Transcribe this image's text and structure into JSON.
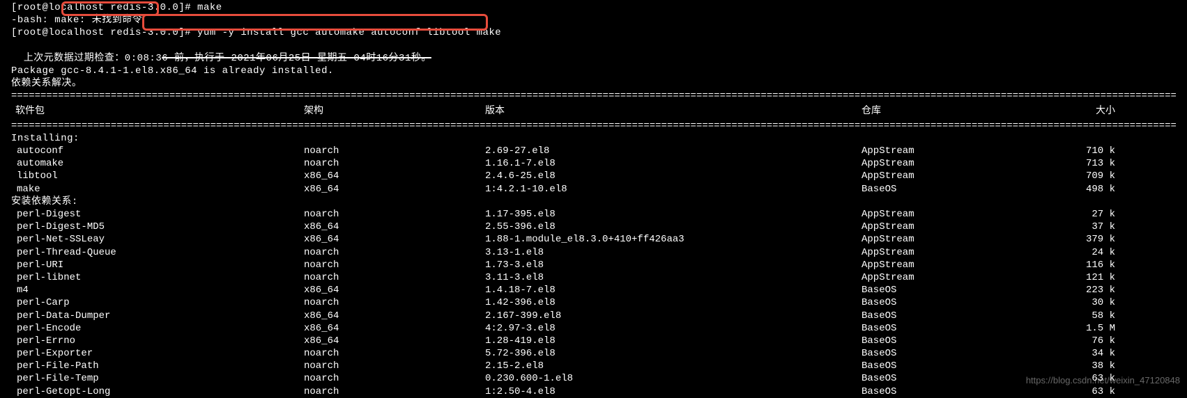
{
  "terminal": {
    "line0": "[root@localhost redis-3.0.0]# make",
    "line1": "-bash: make: 未找到命令",
    "line2": "[root@localhost redis-3.0.0]# yum -y install gcc automake autoconf libtool make",
    "line3_prefix": "上次元数据过期检查：0:08:3",
    "line3_struck": "6 前，执行于 2021年06月25日 星期五 04时16分31秒。",
    "line4": "Package gcc-8.4.1-1.el8.x86_64 is already installed.",
    "line5": "依赖关系解决。"
  },
  "headers": {
    "package": " 软件包",
    "arch": "架构",
    "version": "版本",
    "repo": "仓库",
    "size": "大小"
  },
  "sections": {
    "installing": "Installing:",
    "deps": "安装依赖关系:"
  },
  "installing": [
    {
      "name": "autoconf",
      "arch": "noarch",
      "version": "2.69-27.el8",
      "repo": "AppStream",
      "size": "710 k"
    },
    {
      "name": "automake",
      "arch": "noarch",
      "version": "1.16.1-7.el8",
      "repo": "AppStream",
      "size": "713 k"
    },
    {
      "name": "libtool",
      "arch": "x86_64",
      "version": "2.4.6-25.el8",
      "repo": "AppStream",
      "size": "709 k"
    },
    {
      "name": "make",
      "arch": "x86_64",
      "version": "1:4.2.1-10.el8",
      "repo": "BaseOS",
      "size": "498 k"
    }
  ],
  "deps": [
    {
      "name": "perl-Digest",
      "arch": "noarch",
      "version": "1.17-395.el8",
      "repo": "AppStream",
      "size": "27 k"
    },
    {
      "name": "perl-Digest-MD5",
      "arch": "x86_64",
      "version": "2.55-396.el8",
      "repo": "AppStream",
      "size": "37 k"
    },
    {
      "name": "perl-Net-SSLeay",
      "arch": "x86_64",
      "version": "1.88-1.module_el8.3.0+410+ff426aa3",
      "repo": "AppStream",
      "size": "379 k"
    },
    {
      "name": "perl-Thread-Queue",
      "arch": "noarch",
      "version": "3.13-1.el8",
      "repo": "AppStream",
      "size": "24 k"
    },
    {
      "name": "perl-URI",
      "arch": "noarch",
      "version": "1.73-3.el8",
      "repo": "AppStream",
      "size": "116 k"
    },
    {
      "name": "perl-libnet",
      "arch": "noarch",
      "version": "3.11-3.el8",
      "repo": "AppStream",
      "size": "121 k"
    },
    {
      "name": "m4",
      "arch": "x86_64",
      "version": "1.4.18-7.el8",
      "repo": "BaseOS",
      "size": "223 k"
    },
    {
      "name": "perl-Carp",
      "arch": "noarch",
      "version": "1.42-396.el8",
      "repo": "BaseOS",
      "size": "30 k"
    },
    {
      "name": "perl-Data-Dumper",
      "arch": "x86_64",
      "version": "2.167-399.el8",
      "repo": "BaseOS",
      "size": "58 k"
    },
    {
      "name": "perl-Encode",
      "arch": "x86_64",
      "version": "4:2.97-3.el8",
      "repo": "BaseOS",
      "size": "1.5 M"
    },
    {
      "name": "perl-Errno",
      "arch": "x86_64",
      "version": "1.28-419.el8",
      "repo": "BaseOS",
      "size": "76 k"
    },
    {
      "name": "perl-Exporter",
      "arch": "noarch",
      "version": "5.72-396.el8",
      "repo": "BaseOS",
      "size": "34 k"
    },
    {
      "name": "perl-File-Path",
      "arch": "noarch",
      "version": "2.15-2.el8",
      "repo": "BaseOS",
      "size": "38 k"
    },
    {
      "name": "perl-File-Temp",
      "arch": "noarch",
      "version": "0.230.600-1.el8",
      "repo": "BaseOS",
      "size": "63 k"
    },
    {
      "name": "perl-Getopt-Long",
      "arch": "noarch",
      "version": "1:2.50-4.el8",
      "repo": "BaseOS",
      "size": "63 k"
    }
  ],
  "watermark": "https://blog.csdn.net/weixin_47120848"
}
